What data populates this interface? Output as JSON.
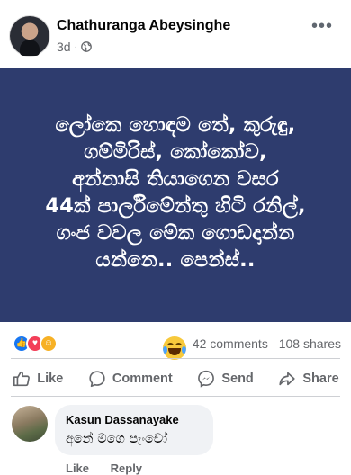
{
  "post": {
    "author": "Chathuranga Abeysinghe",
    "time": "3d",
    "text_lines": [
      "ලෝකෙ හොඳම තේ, කුරුඳු,",
      "ගම්මිරිස්, කෝකෝව,",
      "අන්නාසි තියාගෙන වසර",
      "44ක් පාර්ලිමේන්තු හිටි රනිල්,",
      "ගංජ වවල මේක ගොඩදාන්න",
      "යන්නෙ.. පෙන්ස්.."
    ],
    "background_color": "#2e3c6e"
  },
  "stats": {
    "comments": "42 comments",
    "shares": "108 shares"
  },
  "actions": {
    "like": "Like",
    "comment": "Comment",
    "send": "Send",
    "share": "Share"
  },
  "comment": {
    "author": "Kasun Dassanayake",
    "text": "අනේ මගෙ පැංචෝ",
    "like": "Like",
    "reply": "Reply"
  },
  "icons": {
    "privacy": "globe-icon",
    "more": "more-options-icon",
    "reactions": [
      "like-reaction-icon",
      "love-reaction-icon",
      "haha-reaction-icon"
    ]
  },
  "colors": {
    "accent": "#1877f2",
    "secondary_text": "#65676b"
  }
}
